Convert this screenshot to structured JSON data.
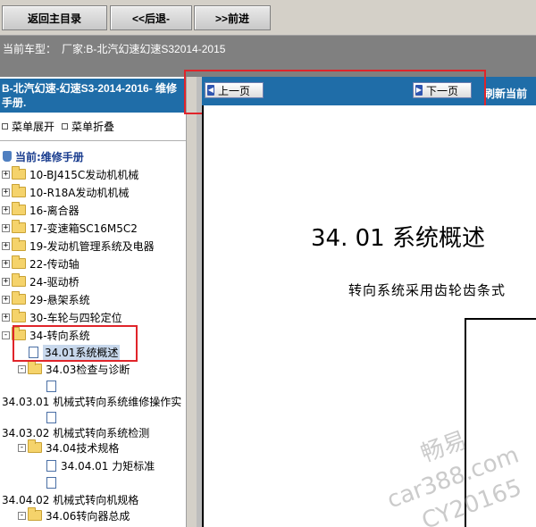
{
  "toolbar": {
    "home_label": "返回主目录",
    "back_label": "<<后退-",
    "forward_label": ">>前进"
  },
  "vehicle": {
    "label": "当前车型：",
    "value": "厂家:B-北汽幻速幻速S32014-2015"
  },
  "left_panel": {
    "manual_title": "B-北汽幻速-幻速S3-2014-2016- 维修手册.",
    "expand_label": "菜单展开",
    "collapse_label": "菜单折叠",
    "root_label": "当前:维修手册",
    "items": [
      "10-BJ415C发动机机械",
      "10-R18A发动机机械",
      "16-离合器",
      "17-变速箱SC16M5C2",
      "19-发动机管理系统及电器",
      "22-传动轴",
      "24-驱动桥",
      "29-悬架系统",
      "30-车轮与四轮定位",
      "34-转向系统",
      "34.01系统概述",
      "34.03检查与诊断",
      "34.03.01 机械式转向系统维修操作实",
      "34.03.02 机械式转向系统检测",
      "34.04技术规格",
      "34.04.01 力矩标准",
      "34.04.02 机械式转向机规格",
      "34.06转向器总成"
    ]
  },
  "content": {
    "prev_label": "上一页",
    "next_label": "下一页",
    "refresh_label": "刷新当前",
    "heading": "34. 01 系统概述",
    "body_text": "转向系统采用齿轮齿条式"
  },
  "watermark": {
    "line1": "畅易",
    "line2": "car388.com",
    "line3": "CY20165"
  }
}
